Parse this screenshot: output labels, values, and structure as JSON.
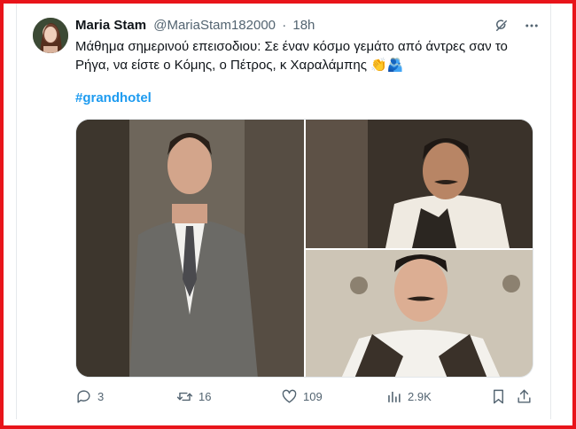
{
  "tweet": {
    "author_name": "Maria Stam",
    "handle": "@MariaStam182000",
    "separator": "·",
    "time": "18h",
    "text": "Μάθημα σημερινού επεισοδιου: Σε έναν κόσμο γεμάτο από άντρες σαν το Ρήγα, να είστε ο Κόμης, ο Πέτρος, κ Χαραλάμπης",
    "emojis": "👏🫂",
    "hashtag": "#grandhotel"
  },
  "actions": {
    "replies": "3",
    "retweets": "16",
    "likes": "109",
    "views": "2.9K"
  },
  "icons": [
    "grok-icon",
    "more-icon",
    "reply-icon",
    "retweet-icon",
    "like-icon",
    "views-icon",
    "bookmark-icon",
    "share-icon"
  ],
  "colors": {
    "accent": "#1d9bf0",
    "muted": "#536471",
    "text": "#0f1419",
    "frame": "#e8141a"
  }
}
